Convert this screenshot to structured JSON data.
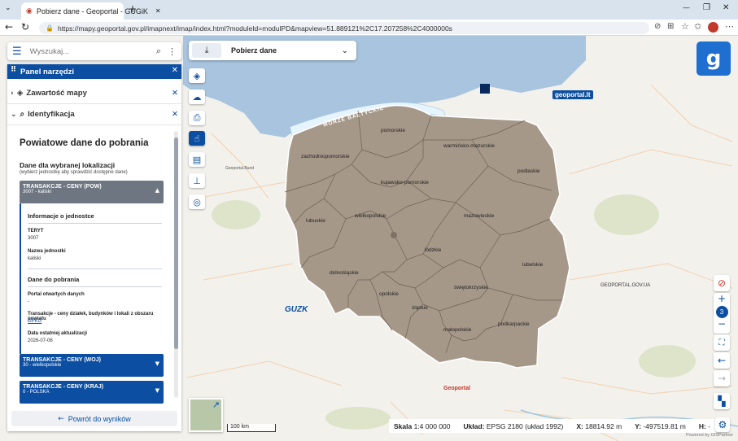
{
  "browser": {
    "tab_title": "Pobierz dane - Geoportal - GUGiK",
    "url": "https://mapy.geoportal.gov.pl/imapnext/imap/index.html?moduleId=modulPD&mapview=51.889121%2C17.207258%2C4000000s"
  },
  "search": {
    "placeholder": "Wyszukaj..."
  },
  "panel": {
    "title": "Panel narzędzi",
    "sections": [
      {
        "label": "Zawartość mapy"
      },
      {
        "label": "Identyfikacja"
      }
    ],
    "heading": "Powiatowe dane do pobrania",
    "subheading": "Dane dla wybranej lokalizacji",
    "hint": "(wybierz jednostkę aby sprawdzić dostępne dane)",
    "items": [
      {
        "title": "TRANSAKCJE - CENY (POW)",
        "sub": "3007 - kaliski"
      },
      {
        "title": "TRANSAKCJE - CENY (WOJ)",
        "sub": "30 - wielkopolskie"
      },
      {
        "title": "TRANSAKCJE - CENY (KRAJ)",
        "sub": "0 - POLSKA"
      }
    ],
    "info_title": "Informacje o jednostce",
    "teryt_label": "TERYT",
    "teryt_value": "3007",
    "name_label": "Nazwa jednostki",
    "name_value": "kaliski",
    "download_title": "Dane do pobrania",
    "portal_label": "Portal otwartych danych",
    "portal_value": "-",
    "trans_label": "Transakcje - ceny działek, budynków i lokali z obszaru powiatu",
    "trans_value": "GPKG",
    "update_label": "Data ostatniej aktualizacji",
    "update_value": "2026-07-06",
    "back_button": "Powrót do wyników"
  },
  "topbar": {
    "pobierz_label": "Pobierz dane"
  },
  "map": {
    "sea_label": "MORZE BAŁTYCKIE",
    "voivodeships": [
      "pomorskie",
      "warmińsko-mazurskie",
      "zachodniopomorskie",
      "podlaskie",
      "kujawsko-pomorskie",
      "lubuskie",
      "wielkopolskie",
      "mazowieckie",
      "łódzkie",
      "lubelskie",
      "dolnośląskie",
      "opolskie",
      "świętokrzyskie",
      "śląskie",
      "małopolskie",
      "podkarpackie"
    ],
    "logo_geoportal_lt": "geoportal.lt",
    "logo_gugik": "GUZK",
    "logo_geoportal": "Geoportal",
    "logo_geoportal_ua": "GEOPORTAL.GOV.UA",
    "logo_de": "Geoportal.Bund",
    "zoom_level": "3",
    "scalebar": "100 km",
    "powered": "Powered by GISPartner"
  },
  "status": {
    "scale_label": "Skala",
    "scale_value": "1:4 000 000",
    "crs_label": "Układ:",
    "crs_value": "EPSG 2180 (układ 1992)",
    "x_label": "X:",
    "x_value": "18814.92 m",
    "y_label": "Y:",
    "y_value": "-497519.81 m",
    "h_label": "H:",
    "h_value": "-"
  },
  "colors": {
    "accent": "#0b4ea2",
    "poland_fill": "#a69889",
    "sea": "#a8c4de"
  }
}
